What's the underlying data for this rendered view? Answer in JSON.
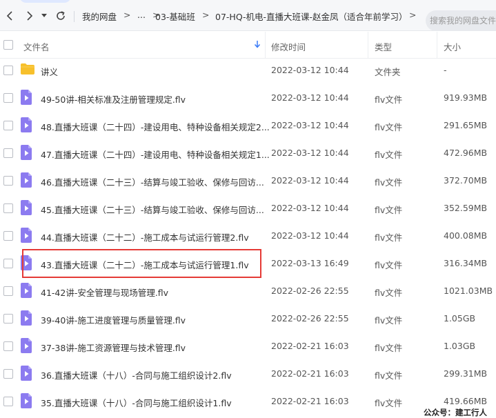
{
  "breadcrumb": [
    "我的网盘",
    "...",
    "03-基础班",
    "07-HQ-机电-直播大班课-赵金凤（适合年前学习）"
  ],
  "search": {
    "placeholder": "搜索我的网盘文件"
  },
  "columns": {
    "name": "文件名",
    "modified": "修改时间",
    "type": "类型",
    "size": "大小"
  },
  "files": [
    {
      "name": "讲义",
      "date": "2022-03-12 10:44",
      "type": "文件夹",
      "size": "-",
      "kind": "folder"
    },
    {
      "name": "49-50讲-相关标准及注册管理规定.flv",
      "date": "2022-03-12 10:44",
      "type": "flv文件",
      "size": "919.93MB",
      "kind": "video"
    },
    {
      "name": "48.直播大班课（二十四）-建设用电、特种设备相关规定2...",
      "date": "2022-03-12 10:44",
      "type": "flv文件",
      "size": "291.65MB",
      "kind": "video"
    },
    {
      "name": "47.直播大班课（二十四）-建设用电、特种设备相关规定1...",
      "date": "2022-03-12 10:44",
      "type": "flv文件",
      "size": "472.96MB",
      "kind": "video"
    },
    {
      "name": "46.直播大班课（二十三）-结算与竣工验收、保修与回访...",
      "date": "2022-03-12 10:44",
      "type": "flv文件",
      "size": "372.70MB",
      "kind": "video"
    },
    {
      "name": "45.直播大班课（二十三）-结算与竣工验收、保修与回访...",
      "date": "2022-03-12 10:44",
      "type": "flv文件",
      "size": "352.59MB",
      "kind": "video"
    },
    {
      "name": "44.直播大班课（二十二）-施工成本与试运行管理2.flv",
      "date": "2022-03-12 10:44",
      "type": "flv文件",
      "size": "400.08MB",
      "kind": "video"
    },
    {
      "name": "43.直播大班课（二十二）-施工成本与试运行管理1.flv",
      "date": "2022-03-13 16:49",
      "type": "flv文件",
      "size": "316.34MB",
      "kind": "video"
    },
    {
      "name": "41-42讲-安全管理与现场管理.flv",
      "date": "2022-02-26 22:55",
      "type": "flv文件",
      "size": "1021.03MB",
      "kind": "video"
    },
    {
      "name": "39-40讲-施工进度管理与质量管理.flv",
      "date": "2022-02-26 22:55",
      "type": "flv文件",
      "size": "1.05GB",
      "kind": "video"
    },
    {
      "name": "37-38讲-施工资源管理与技术管理.flv",
      "date": "2022-02-21 16:03",
      "type": "flv文件",
      "size": "1.03GB",
      "kind": "video"
    },
    {
      "name": "36.直播大班课（十八）-合同与施工组织设计2.flv",
      "date": "2022-02-21 16:03",
      "type": "flv文件",
      "size": "299.31MB",
      "kind": "video"
    },
    {
      "name": "35.直播大班课（十八）-合同与施工组织设计1.flv",
      "date": "2022-02-21 16:03",
      "type": "flv文件",
      "size": "419.66MB",
      "kind": "video"
    }
  ],
  "watermark": "公众号：建工行人",
  "colors": {
    "folder": "#f7c02c",
    "video": "#8c7bf0",
    "highlight": "#e53935"
  }
}
